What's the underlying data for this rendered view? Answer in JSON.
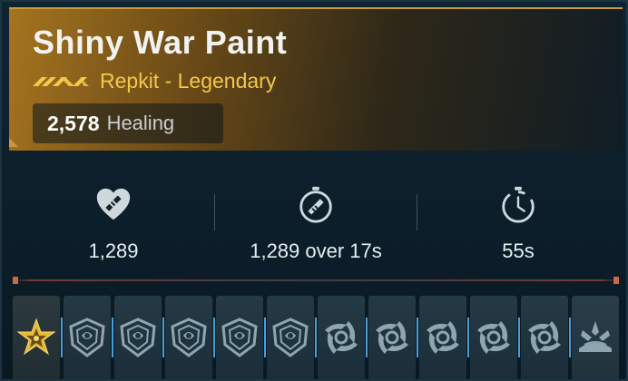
{
  "item": {
    "name": "Shiny War Paint",
    "subtitle": "Repkit - Legendary",
    "rarity_icon": "legendary-chevrons-icon",
    "stat_value": "2,578",
    "stat_label": "Healing"
  },
  "stats": [
    {
      "icon": "heart-bandage-icon",
      "value": "1,289"
    },
    {
      "icon": "timer-bandage-icon",
      "value": "1,289 over 17s"
    },
    {
      "icon": "cooldown-timer-icon",
      "value": "55s"
    }
  ],
  "slots": [
    {
      "icon": "star-badge-icon"
    },
    {
      "icon": "shield-swirl-icon"
    },
    {
      "icon": "shield-swirl-icon"
    },
    {
      "icon": "shield-swirl-icon"
    },
    {
      "icon": "shield-swirl-icon"
    },
    {
      "icon": "shield-swirl-icon"
    },
    {
      "icon": "vortex-icon"
    },
    {
      "icon": "vortex-icon"
    },
    {
      "icon": "vortex-icon"
    },
    {
      "icon": "vortex-icon"
    },
    {
      "icon": "vortex-icon"
    },
    {
      "icon": "splash-icon"
    }
  ],
  "colors": {
    "legendary": "#f4c84a",
    "header_gold": "#a5741f",
    "slot_accent": "#4a9ed8",
    "separator_accent": "#c86b44"
  }
}
